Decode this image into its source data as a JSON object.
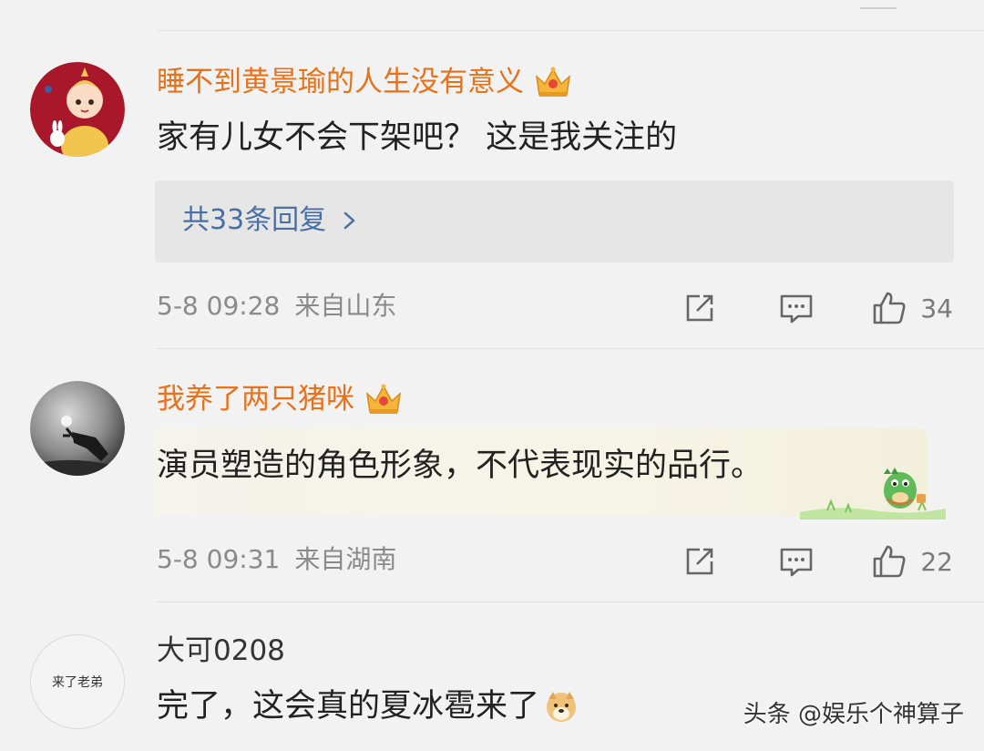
{
  "comments": [
    {
      "username": "睡不到黄景瑜的人生没有意义",
      "content": "家有儿女不会下架吧？  这是我关注的",
      "replies_label": "共33条回复",
      "date": "5-8 09:28",
      "location": "来自山东",
      "likes": "34",
      "vip": true,
      "crown_icon": "crown-icon"
    },
    {
      "username": "我养了两只猪咪",
      "content": "演员塑造的角色形象，不代表现实的品行。",
      "date": "5-8 09:31",
      "location": "来自湖南",
      "likes": "22",
      "vip": true,
      "crown_icon": "crown-icon",
      "sticker_icon": "dinosaur-sticker-icon"
    },
    {
      "username": "大可0208",
      "avatar_text": "来了老弟",
      "content": "完了，这会真的夏冰雹来了",
      "emoji_icon": "doge-emoji-icon",
      "vip": false
    }
  ],
  "watermark": "头条 @娱乐个神算子",
  "colors": {
    "background": "#f2f2f2",
    "vip_name": "#e8711a",
    "link": "#4a6ea6",
    "meta": "#8a8a8a"
  },
  "icons": [
    "share-icon",
    "reply-icon",
    "like-icon",
    "chevron-right-icon"
  ]
}
